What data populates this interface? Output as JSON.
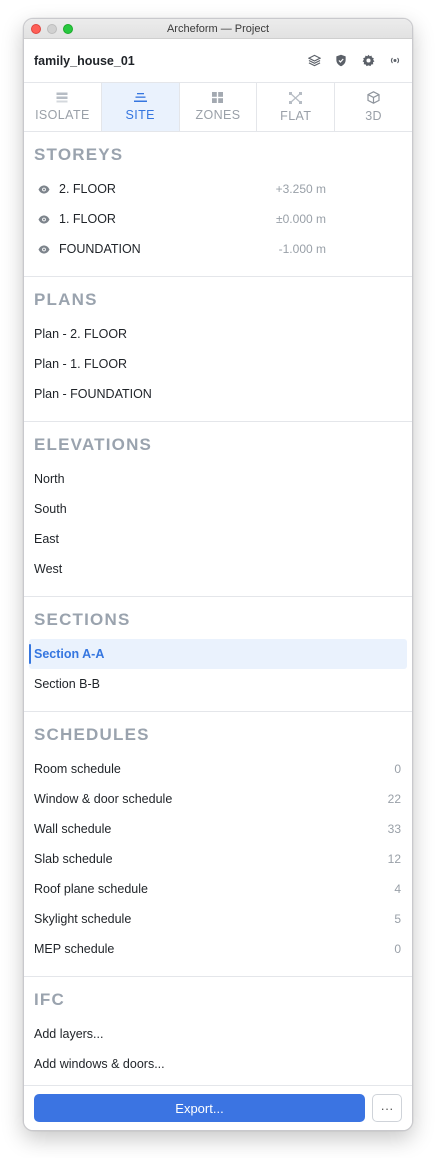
{
  "window": {
    "title": "Archeform — Project"
  },
  "header": {
    "project_name": "family_house_01",
    "icons": [
      "layers-icon",
      "shield-icon",
      "settings-icon",
      "broadcast-icon"
    ]
  },
  "tabs": [
    {
      "label": "ISOLATE",
      "icon": "isolate-icon",
      "active": false
    },
    {
      "label": "SITE",
      "icon": "site-icon",
      "active": true
    },
    {
      "label": "ZONES",
      "icon": "zones-icon",
      "active": false
    },
    {
      "label": "FLAT",
      "icon": "flat-icon",
      "active": false
    },
    {
      "label": "3D",
      "icon": "cube-icon",
      "active": false
    }
  ],
  "storeys": {
    "title": "STOREYS",
    "items": [
      {
        "label": "2. FLOOR",
        "value": "+3.250 m"
      },
      {
        "label": "1. FLOOR",
        "value": "±0.000 m"
      },
      {
        "label": "FOUNDATION",
        "value": "-1.000 m"
      }
    ]
  },
  "plans": {
    "title": "PLANS",
    "items": [
      {
        "label": "Plan - 2. FLOOR"
      },
      {
        "label": "Plan - 1. FLOOR"
      },
      {
        "label": "Plan - FOUNDATION"
      }
    ]
  },
  "elevations": {
    "title": "ELEVATIONS",
    "items": [
      {
        "label": "North"
      },
      {
        "label": "South"
      },
      {
        "label": "East"
      },
      {
        "label": "West"
      }
    ]
  },
  "sections": {
    "title": "SECTIONS",
    "items": [
      {
        "label": "Section A-A",
        "selected": true
      },
      {
        "label": "Section B-B",
        "selected": false
      }
    ]
  },
  "schedules": {
    "title": "SCHEDULES",
    "items": [
      {
        "label": "Room schedule",
        "count": "0"
      },
      {
        "label": "Window & door schedule",
        "count": "22"
      },
      {
        "label": "Wall schedule",
        "count": "33"
      },
      {
        "label": "Slab schedule",
        "count": "12"
      },
      {
        "label": "Roof plane schedule",
        "count": "4"
      },
      {
        "label": "Skylight schedule",
        "count": "5"
      },
      {
        "label": "MEP schedule",
        "count": "0"
      }
    ]
  },
  "ifc": {
    "title": "IFC",
    "items": [
      {
        "label": "Add layers..."
      },
      {
        "label": "Add windows & doors..."
      }
    ]
  },
  "footer": {
    "export_label": "Export...",
    "more_label": "···"
  },
  "colors": {
    "accent": "#3b74e2",
    "active_tab_bg": "#eaf2fd",
    "section_title": "#9aa3ae"
  }
}
